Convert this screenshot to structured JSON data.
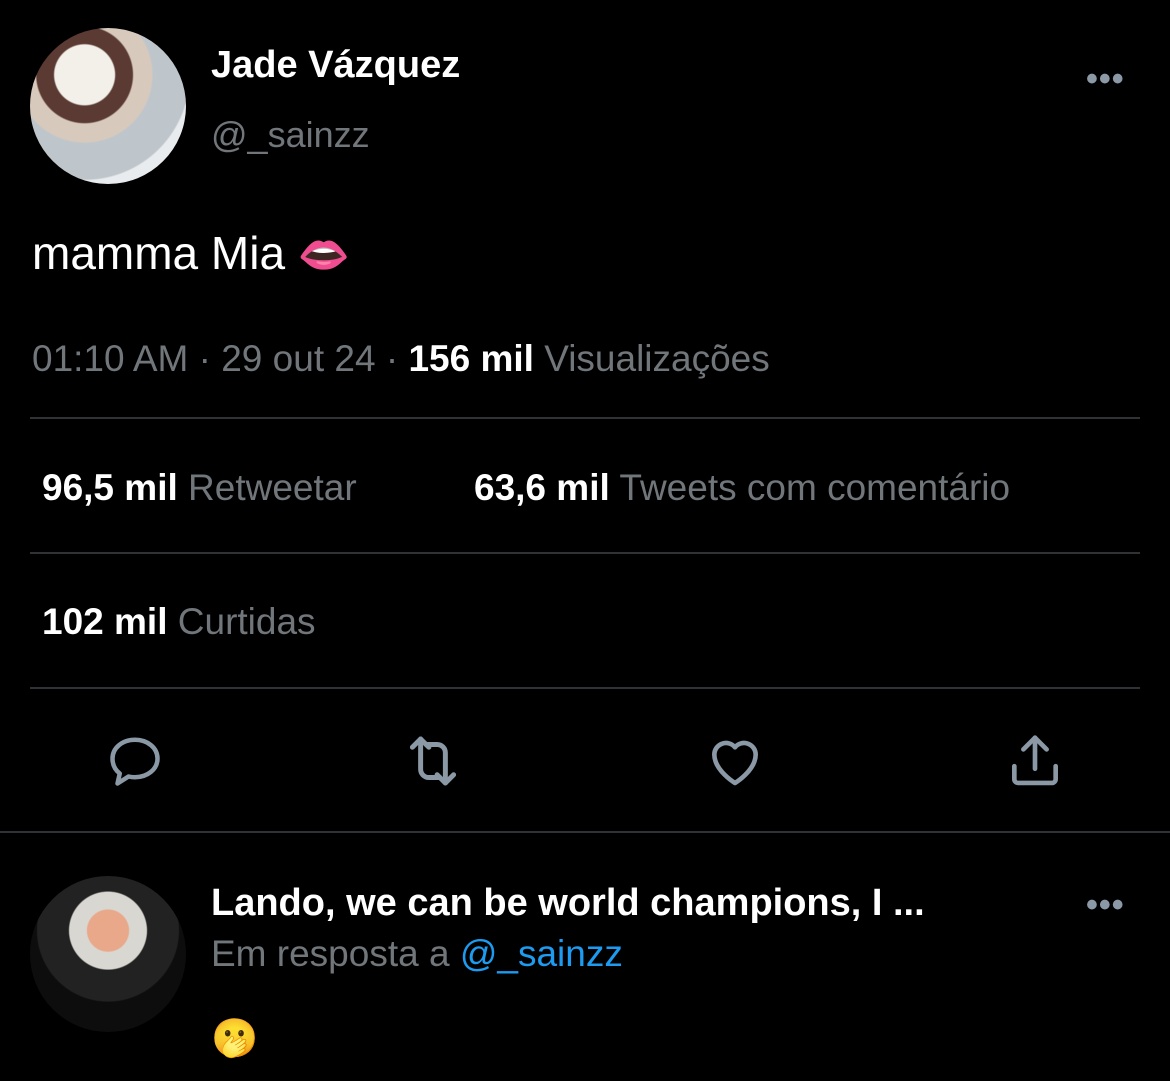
{
  "tweet": {
    "author_name": "Jade Vázquez",
    "author_handle": "@_sainzz",
    "text": "mamma Mia",
    "emoji": "👄",
    "time": "01:10 AM",
    "date": "29 out 24",
    "views_count": "156 mil",
    "views_label": "Visualizações",
    "retweets_count": "96,5 mil",
    "retweets_label": "Retweetar",
    "quotes_count": "63,6 mil",
    "quotes_label": "Tweets com comentário",
    "likes_count": "102 mil",
    "likes_label": "Curtidas"
  },
  "actions": {
    "reply_icon": "reply-icon",
    "retweet_icon": "retweet-icon",
    "like_icon": "heart-icon",
    "share_icon": "share-icon"
  },
  "reply": {
    "author_name": "Lando, we can be world champions, I ...",
    "reply_prefix": "Em resposta a",
    "reply_to": "@_sainzz",
    "text": "🫢"
  },
  "colors": {
    "background": "#000000",
    "text": "#ffffff",
    "muted": "#71767b",
    "link": "#1d9bf0",
    "divider": "#2f3336"
  }
}
